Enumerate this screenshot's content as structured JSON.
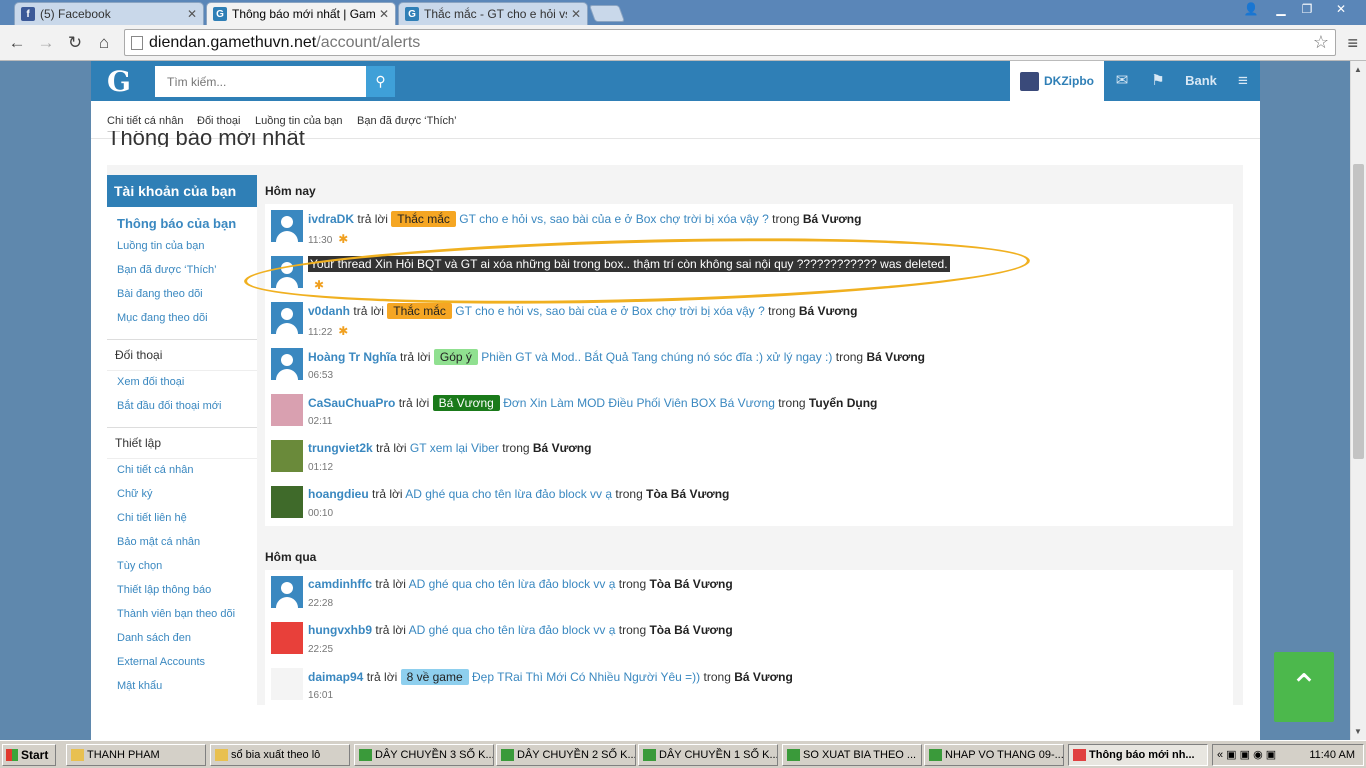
{
  "browser": {
    "tabs": [
      {
        "label": "(5) Facebook",
        "icon": "facebook-icon",
        "color": "#3b5998",
        "glyph": "f"
      },
      {
        "label": "Thông báo mới nhất | Game t",
        "icon": "gamethu-icon",
        "color": "#2f7fb6",
        "glyph": "G"
      },
      {
        "label": "Thắc mắc - GT cho e hỏi vs, s",
        "icon": "gamethu-icon",
        "color": "#2f7fb6",
        "glyph": "G"
      }
    ],
    "url_host": "diendan.gamethuvn.net",
    "url_path": "/account/alerts"
  },
  "site": {
    "logo": "G",
    "search_placeholder": "Tìm kiếm...",
    "username": "DKZipbo",
    "bank_label": "Bank",
    "subnav": [
      "Chi tiết cá nhân",
      "Đối thoại",
      "Luồng tin của bạn",
      "Bạn đã được ‘Thích’"
    ],
    "page_title": "Thông báo mới nhất"
  },
  "sidebar": {
    "account_head": "Tài khoản của bạn",
    "account_links": [
      "Thông báo của bạn",
      "Luồng tin của bạn",
      "Bạn đã được ‘Thích’",
      "Bài đang theo dõi",
      "Mục đang theo dõi"
    ],
    "conv_head": "Đối thoại",
    "conv_links": [
      "Xem đối thoại",
      "Bắt đầu đối thoại mới"
    ],
    "settings_head": "Thiết lập",
    "settings_links": [
      "Chi tiết cá nhân",
      "Chữ ký",
      "Chi tiết liên hệ",
      "Bảo mật cá nhân",
      "Tùy chọn",
      "Thiết lập thông báo",
      "Thành viên bạn theo dõi",
      "Danh sách đen",
      "External Accounts",
      "Mật khẩu"
    ]
  },
  "alerts": {
    "today_label": "Hôm nay",
    "yesterday_label": "Hôm qua",
    "replied": "trả lời",
    "in": "trong",
    "today": [
      {
        "user": "ivdraDK",
        "prefix": "Thắc mắc",
        "prefix_class": "pre-orange",
        "thread": "GT cho e hỏi vs, sao bài của e ở Box chợ trời bị xóa vậy ?",
        "forum": "Bá Vương",
        "time": "11:30",
        "new": "✱",
        "avatar": "default"
      },
      {
        "deleted": "Your thread Xin Hỏi BQT và GT ai xóa những bài trong box.. thậm trí còn không sai nội quy ???????????? was deleted.",
        "time": "",
        "new": "✱",
        "avatar": "default"
      },
      {
        "user": "v0danh",
        "prefix": "Thắc mắc",
        "prefix_class": "pre-orange",
        "thread": "GT cho e hỏi vs, sao bài của e ở Box chợ trời bị xóa vậy ?",
        "forum": "Bá Vương",
        "time": "11:22",
        "new": "✱",
        "avatar": "default"
      },
      {
        "user": "Hoàng Tr Nghĩa",
        "prefix": "Góp ý",
        "prefix_class": "pre-green",
        "thread": "Phiền GT và Mod.. Bắt Quả Tang chúng nó sóc đĩa :) xử lý ngay :)",
        "forum": "Bá Vương",
        "time": "06:53",
        "avatar": "default"
      },
      {
        "user": "CaSauChuaPro",
        "prefix": "Bá Vương",
        "prefix_class": "pre-dkgreen",
        "thread": "Đơn Xin Làm MOD Điều Phối Viên BOX Bá Vương",
        "forum": "Tuyển Dụng",
        "time": "02:11",
        "avatar": "photo-pink"
      },
      {
        "user": "trungviet2k",
        "thread": "GT xem lại Viber",
        "forum": "Bá Vương",
        "time": "01:12",
        "avatar": "photo-green"
      },
      {
        "user": "hoangdieu",
        "thread": "AD ghé qua cho tên lừa đảo block vv ạ",
        "forum": "Tòa Bá Vương",
        "time": "00:10",
        "avatar": "photo-forest"
      }
    ],
    "yesterday": [
      {
        "user": "camdinhffc",
        "thread": "AD ghé qua cho tên lừa đảo block vv ạ",
        "forum": "Tòa Bá Vương",
        "time": "22:28",
        "avatar": "default"
      },
      {
        "user": "hungvxhb9",
        "thread": "AD ghé qua cho tên lừa đảo block vv ạ",
        "forum": "Tòa Bá Vương",
        "time": "22:25",
        "avatar": "photo-red"
      },
      {
        "user": "daimap94",
        "prefix": "8 về game",
        "prefix_class": "pre-blue",
        "thread": "Đẹp TRai Thì Mới Có Nhiều Người Yêu =))",
        "forum": "Bá Vương",
        "time": "16:01",
        "avatar": "photo-crest"
      }
    ]
  },
  "taskbar": {
    "start": "Start",
    "items": [
      "THANH PHAM",
      "sổ bia xuất theo lô",
      "DÂY CHUYỀN 3 SỐ K...",
      "DÂY CHUYỀN 2 SỐ K...",
      "DÂY CHUYỀN 1 SỐ K...",
      "SO XUAT BIA THEO ...",
      "NHAP VO THANG 09-...",
      "Thông báo mới nh..."
    ],
    "clock": "11:40 AM"
  }
}
